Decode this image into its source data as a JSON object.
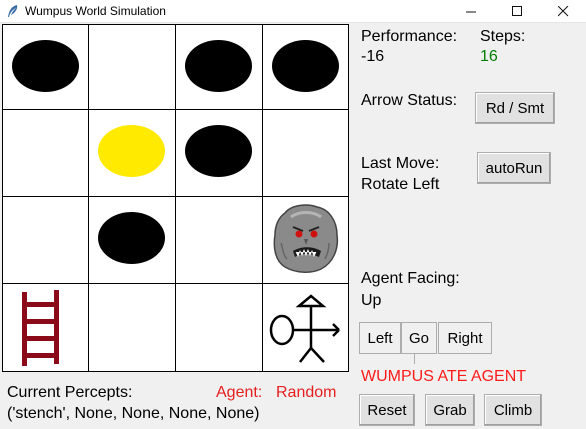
{
  "window": {
    "title": "Wumpus World Simulation",
    "icons": [
      "feather-icon",
      "minimize-icon",
      "maximize-icon",
      "close-icon"
    ]
  },
  "board": {
    "cells": [
      [
        "pit",
        "empty",
        "pit",
        "pit"
      ],
      [
        "empty",
        "gold",
        "pit",
        "empty"
      ],
      [
        "empty",
        "pit",
        "empty",
        "wumpus"
      ],
      [
        "ladder",
        "empty",
        "empty",
        "agent"
      ]
    ]
  },
  "panel": {
    "performance_label": "Performance:",
    "performance_value": "-16",
    "steps_label": "Steps:",
    "steps_value": "16",
    "steps_color": "#008000",
    "arrow_label": "Arrow Status:",
    "last_move_label": "Last Move:",
    "last_move_value": "Rotate Left",
    "facing_label": "Agent Facing:",
    "facing_value": "Up",
    "status_message": "WUMPUS ATE AGENT",
    "status_color": "#ff1a1a",
    "percepts_label": "Current Percepts:",
    "percepts_value": "('stench', None, None, None, None)",
    "agent_label": "Agent:",
    "agent_value": "Random",
    "agent_color": "#e61e1e"
  },
  "buttons": {
    "rd_smt": "Rd / Smt",
    "autorun": "autoRun",
    "left": "Left",
    "go": "Go",
    "right": "Right",
    "reset": "Reset",
    "grab": "Grab",
    "climb": "Climb"
  }
}
